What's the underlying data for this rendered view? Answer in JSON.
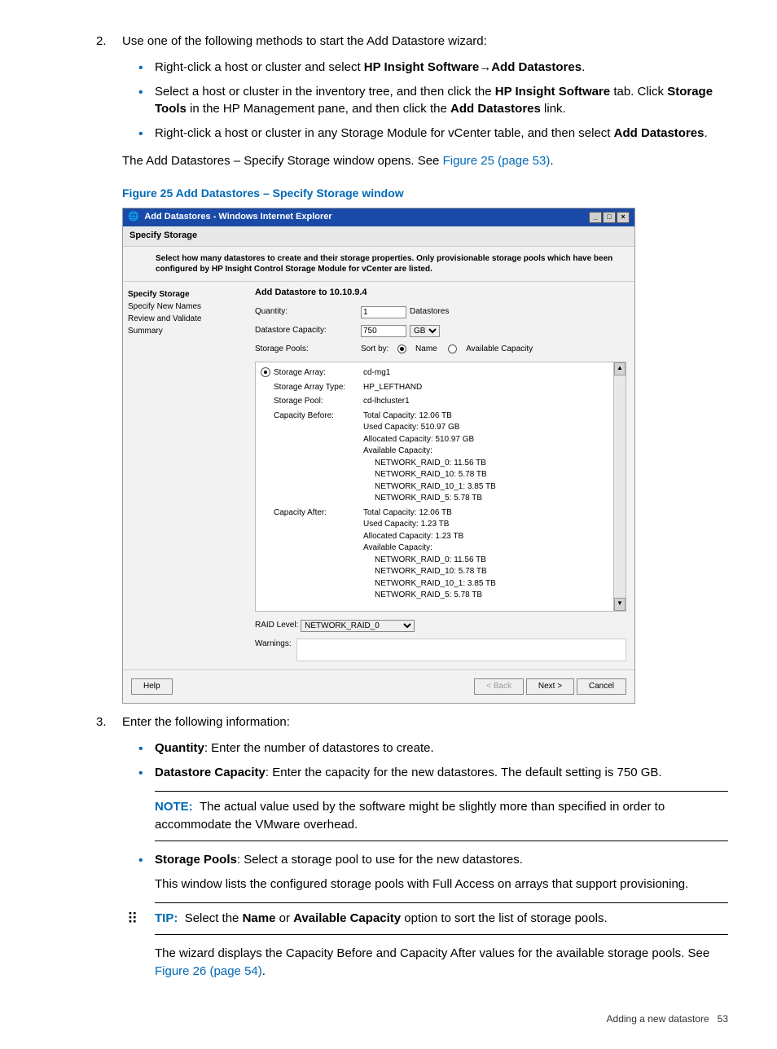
{
  "step2": {
    "num": "2.",
    "intro": "Use one of the following methods to start the Add Datastore wizard:",
    "bullets": {
      "b1_pre": "Right-click a host or cluster and select ",
      "b1_bold1": "HP Insight Software",
      "b1_arrow": "→",
      "b1_bold2": "Add Datastores",
      "b1_post": ".",
      "b2_pre": "Select a host or cluster in the inventory tree, and then click the ",
      "b2_bold1": "HP Insight Software",
      "b2_mid": " tab. Click ",
      "b2_bold2": "Storage Tools",
      "b2_mid2": " in the HP Management pane, and then click the ",
      "b2_bold3": "Add Datastores",
      "b2_post": " link.",
      "b3_pre": "Right-click a host or cluster in any Storage Module for vCenter table, and then select ",
      "b3_bold1": "Add Datastores",
      "b3_post": "."
    },
    "outro_pre": "The Add Datastores – Specify Storage window opens. See ",
    "outro_link": "Figure 25 (page 53)",
    "outro_post": "."
  },
  "figure_caption": "Figure 25 Add Datastores – Specify Storage window",
  "shot": {
    "title": "Add Datastores - Windows Internet Explorer",
    "tab": "Specify Storage",
    "instruct": "Select how many datastores to create and their storage properties. Only provisionable storage pools which have been configured by HP Insight Control Storage Module for vCenter are listed.",
    "side": {
      "s1": "Specify Storage",
      "s2": "Specify New Names",
      "s3": "Review and Validate",
      "s4": "Summary"
    },
    "main": {
      "header": "Add Datastore to 10.10.9.4",
      "qty_label": "Quantity:",
      "qty_value": "1",
      "qty_unit": "Datastores",
      "cap_label": "Datastore Capacity:",
      "cap_value": "750",
      "cap_unit": "GB",
      "pools_label": "Storage Pools:",
      "sort_label": "Sort by:",
      "sort_name": "Name",
      "sort_cap": "Available Capacity",
      "pool": {
        "r1l": "Storage Array:",
        "r1v": "cd-mg1",
        "r2l": "Storage Array Type:",
        "r2v": "HP_LEFTHAND",
        "r3l": "Storage Pool:",
        "r3v": "cd-lhcluster1",
        "r4l": "Capacity Before:",
        "r4a": "Total Capacity: 12.06 TB",
        "r4b": "Used Capacity: 510.97 GB",
        "r4c": "Allocated Capacity: 510.97 GB",
        "r4d": "Available Capacity:",
        "r4e": "NETWORK_RAID_0: 11.56 TB",
        "r4f": "NETWORK_RAID_10: 5.78 TB",
        "r4g": "NETWORK_RAID_10_1: 3.85 TB",
        "r4h": "NETWORK_RAID_5: 5.78 TB",
        "r5l": "Capacity After:",
        "r5a": "Total Capacity: 12.06 TB",
        "r5b": "Used Capacity: 1.23 TB",
        "r5c": "Allocated Capacity: 1.23 TB",
        "r5d": "Available Capacity:",
        "r5e": "NETWORK_RAID_0: 11.56 TB",
        "r5f": "NETWORK_RAID_10: 5.78 TB",
        "r5g": "NETWORK_RAID_10_1: 3.85 TB",
        "r5h": "NETWORK_RAID_5: 5.78 TB"
      },
      "raid_label": "RAID Level:",
      "raid_value": "NETWORK_RAID_0",
      "warn_label": "Warnings:"
    },
    "footer": {
      "help": "Help",
      "back": "< Back",
      "next": "Next >",
      "cancel": "Cancel"
    }
  },
  "step3": {
    "num": "3.",
    "intro": "Enter the following information:",
    "q_label": "Quantity",
    "q_text": ": Enter the number of datastores to create.",
    "dc_label": "Datastore Capacity",
    "dc_text": ": Enter the capacity for the new datastores. The default setting is 750 GB.",
    "note_label": "NOTE:",
    "note_text": "The actual value used by the software might be slightly more than specified in order to accommodate the VMware overhead.",
    "sp_label": "Storage Pools",
    "sp_text": ": Select a storage pool to use for the new datastores.",
    "sp_text2": "This window lists the configured storage pools with Full Access on arrays that support provisioning.",
    "tip_label": "TIP:",
    "tip_pre": "Select the ",
    "tip_b1": "Name",
    "tip_mid": " or ",
    "tip_b2": "Available Capacity",
    "tip_post": " option to sort the list of storage pools.",
    "after_tip_pre": "The wizard displays the Capacity Before and Capacity After values for the available storage pools. See ",
    "after_tip_link": "Figure 26 (page 54)",
    "after_tip_post": "."
  },
  "page_footer": {
    "label": "Adding a new datastore",
    "page": "53"
  }
}
